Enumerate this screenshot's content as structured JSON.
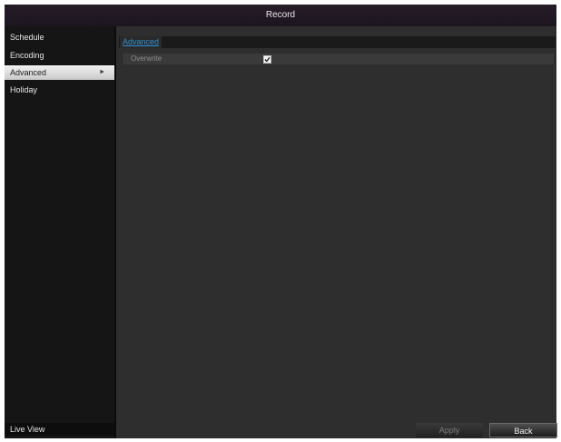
{
  "window": {
    "title": "Record"
  },
  "sidebar": {
    "items": [
      {
        "label": "Schedule",
        "active": false
      },
      {
        "label": "Encoding",
        "active": false
      },
      {
        "label": "Advanced",
        "active": true
      },
      {
        "label": "Holiday",
        "active": false
      }
    ],
    "active_arrow_icon": "arrow-right-icon",
    "footer_label": "Live View"
  },
  "main": {
    "tabs": [
      {
        "label": "Advanced",
        "active": true
      }
    ],
    "settings": [
      {
        "label": "Overwrite",
        "checked": true,
        "icon": "checkmark-icon"
      }
    ]
  },
  "footer": {
    "apply_label": "Apply",
    "back_label": "Back"
  }
}
